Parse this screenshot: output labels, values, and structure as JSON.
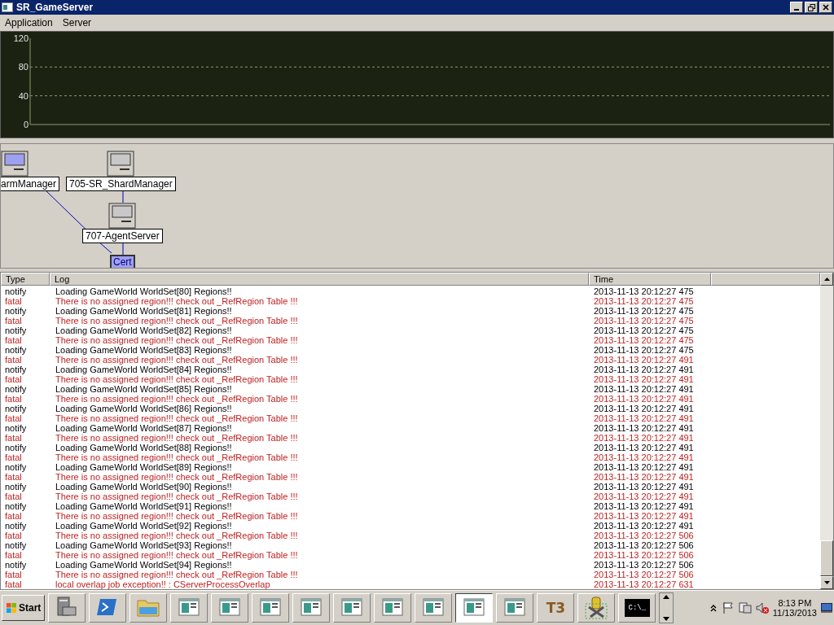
{
  "window": {
    "title": "SR_GameServer"
  },
  "menu": [
    "Application",
    "Server"
  ],
  "chart": {
    "axis_labels": [
      "120",
      "80",
      "40",
      "0"
    ]
  },
  "diagram": {
    "nodes": [
      {
        "label": "armManager",
        "active": true,
        "kind": "labeled"
      },
      {
        "label": "705-SR_ShardManager",
        "active": false,
        "kind": "labeled"
      },
      {
        "label": "707-AgentServer",
        "active": false,
        "kind": "labeled"
      },
      {
        "label": "Cert",
        "active": true,
        "kind": "inline"
      }
    ]
  },
  "log": {
    "columns": [
      "Type",
      "Log",
      "Time"
    ],
    "rows": [
      {
        "type": "notify",
        "log": "Loading GameWorld WorldSet[80] Regions!!",
        "time": "2013-11-13 20:12:27 475"
      },
      {
        "type": "fatal",
        "log": "There is no assigned region!!! check out _RefRegion Table !!!",
        "time": "2013-11-13 20:12:27 475"
      },
      {
        "type": "notify",
        "log": "Loading GameWorld WorldSet[81] Regions!!",
        "time": "2013-11-13 20:12:27 475"
      },
      {
        "type": "fatal",
        "log": "There is no assigned region!!! check out _RefRegion Table !!!",
        "time": "2013-11-13 20:12:27 475"
      },
      {
        "type": "notify",
        "log": "Loading GameWorld WorldSet[82] Regions!!",
        "time": "2013-11-13 20:12:27 475"
      },
      {
        "type": "fatal",
        "log": "There is no assigned region!!! check out _RefRegion Table !!!",
        "time": "2013-11-13 20:12:27 475"
      },
      {
        "type": "notify",
        "log": "Loading GameWorld WorldSet[83] Regions!!",
        "time": "2013-11-13 20:12:27 475"
      },
      {
        "type": "fatal",
        "log": "There is no assigned region!!! check out _RefRegion Table !!!",
        "time": "2013-11-13 20:12:27 491"
      },
      {
        "type": "notify",
        "log": "Loading GameWorld WorldSet[84] Regions!!",
        "time": "2013-11-13 20:12:27 491"
      },
      {
        "type": "fatal",
        "log": "There is no assigned region!!! check out _RefRegion Table !!!",
        "time": "2013-11-13 20:12:27 491"
      },
      {
        "type": "notify",
        "log": "Loading GameWorld WorldSet[85] Regions!!",
        "time": "2013-11-13 20:12:27 491"
      },
      {
        "type": "fatal",
        "log": "There is no assigned region!!! check out _RefRegion Table !!!",
        "time": "2013-11-13 20:12:27 491"
      },
      {
        "type": "notify",
        "log": "Loading GameWorld WorldSet[86] Regions!!",
        "time": "2013-11-13 20:12:27 491"
      },
      {
        "type": "fatal",
        "log": "There is no assigned region!!! check out _RefRegion Table !!!",
        "time": "2013-11-13 20:12:27 491"
      },
      {
        "type": "notify",
        "log": "Loading GameWorld WorldSet[87] Regions!!",
        "time": "2013-11-13 20:12:27 491"
      },
      {
        "type": "fatal",
        "log": "There is no assigned region!!! check out _RefRegion Table !!!",
        "time": "2013-11-13 20:12:27 491"
      },
      {
        "type": "notify",
        "log": "Loading GameWorld WorldSet[88] Regions!!",
        "time": "2013-11-13 20:12:27 491"
      },
      {
        "type": "fatal",
        "log": "There is no assigned region!!! check out _RefRegion Table !!!",
        "time": "2013-11-13 20:12:27 491"
      },
      {
        "type": "notify",
        "log": "Loading GameWorld WorldSet[89] Regions!!",
        "time": "2013-11-13 20:12:27 491"
      },
      {
        "type": "fatal",
        "log": "There is no assigned region!!! check out _RefRegion Table !!!",
        "time": "2013-11-13 20:12:27 491"
      },
      {
        "type": "notify",
        "log": "Loading GameWorld WorldSet[90] Regions!!",
        "time": "2013-11-13 20:12:27 491"
      },
      {
        "type": "fatal",
        "log": "There is no assigned region!!! check out _RefRegion Table !!!",
        "time": "2013-11-13 20:12:27 491"
      },
      {
        "type": "notify",
        "log": "Loading GameWorld WorldSet[91] Regions!!",
        "time": "2013-11-13 20:12:27 491"
      },
      {
        "type": "fatal",
        "log": "There is no assigned region!!! check out _RefRegion Table !!!",
        "time": "2013-11-13 20:12:27 491"
      },
      {
        "type": "notify",
        "log": "Loading GameWorld WorldSet[92] Regions!!",
        "time": "2013-11-13 20:12:27 491"
      },
      {
        "type": "fatal",
        "log": "There is no assigned region!!! check out _RefRegion Table !!!",
        "time": "2013-11-13 20:12:27 506"
      },
      {
        "type": "notify",
        "log": "Loading GameWorld WorldSet[93] Regions!!",
        "time": "2013-11-13 20:12:27 506"
      },
      {
        "type": "fatal",
        "log": "There is no assigned region!!! check out _RefRegion Table !!!",
        "time": "2013-11-13 20:12:27 506"
      },
      {
        "type": "notify",
        "log": "Loading GameWorld WorldSet[94] Regions!!",
        "time": "2013-11-13 20:12:27 506"
      },
      {
        "type": "fatal",
        "log": "There is no assigned region!!! check out _RefRegion Table !!!",
        "time": "2013-11-13 20:12:27 506"
      },
      {
        "type": "fatal",
        "log": "local overlap job exception!! : CServerProcessOverlap",
        "time": "2013-11-13 20:12:27 631"
      }
    ]
  },
  "taskbar": {
    "start": "Start",
    "items": [
      {
        "kind": "server",
        "selected": false
      },
      {
        "kind": "shell",
        "selected": false
      },
      {
        "kind": "folder",
        "selected": false
      },
      {
        "kind": "window",
        "selected": false
      },
      {
        "kind": "window",
        "selected": false
      },
      {
        "kind": "window",
        "selected": false
      },
      {
        "kind": "window",
        "selected": false
      },
      {
        "kind": "window",
        "selected": false
      },
      {
        "kind": "window",
        "selected": false
      },
      {
        "kind": "window",
        "selected": false
      },
      {
        "kind": "window",
        "selected": true
      },
      {
        "kind": "window",
        "selected": false
      },
      {
        "kind": "text",
        "label": "T3",
        "selected": false
      },
      {
        "kind": "tools",
        "selected": false
      },
      {
        "kind": "console",
        "label": "C:\\_",
        "selected": false
      }
    ],
    "time": "8:13 PM",
    "date": "11/13/2013"
  }
}
